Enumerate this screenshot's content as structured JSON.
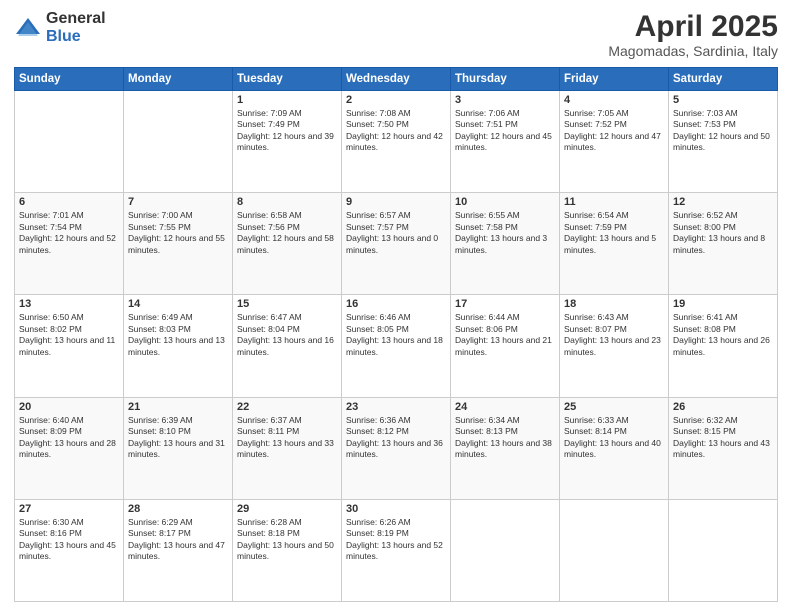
{
  "logo": {
    "general": "General",
    "blue": "Blue"
  },
  "title": {
    "month": "April 2025",
    "location": "Magomadas, Sardinia, Italy"
  },
  "weekdays": [
    "Sunday",
    "Monday",
    "Tuesday",
    "Wednesday",
    "Thursday",
    "Friday",
    "Saturday"
  ],
  "weeks": [
    [
      {
        "day": "",
        "info": ""
      },
      {
        "day": "",
        "info": ""
      },
      {
        "day": "1",
        "info": "Sunrise: 7:09 AM\nSunset: 7:49 PM\nDaylight: 12 hours and 39 minutes."
      },
      {
        "day": "2",
        "info": "Sunrise: 7:08 AM\nSunset: 7:50 PM\nDaylight: 12 hours and 42 minutes."
      },
      {
        "day": "3",
        "info": "Sunrise: 7:06 AM\nSunset: 7:51 PM\nDaylight: 12 hours and 45 minutes."
      },
      {
        "day": "4",
        "info": "Sunrise: 7:05 AM\nSunset: 7:52 PM\nDaylight: 12 hours and 47 minutes."
      },
      {
        "day": "5",
        "info": "Sunrise: 7:03 AM\nSunset: 7:53 PM\nDaylight: 12 hours and 50 minutes."
      }
    ],
    [
      {
        "day": "6",
        "info": "Sunrise: 7:01 AM\nSunset: 7:54 PM\nDaylight: 12 hours and 52 minutes."
      },
      {
        "day": "7",
        "info": "Sunrise: 7:00 AM\nSunset: 7:55 PM\nDaylight: 12 hours and 55 minutes."
      },
      {
        "day": "8",
        "info": "Sunrise: 6:58 AM\nSunset: 7:56 PM\nDaylight: 12 hours and 58 minutes."
      },
      {
        "day": "9",
        "info": "Sunrise: 6:57 AM\nSunset: 7:57 PM\nDaylight: 13 hours and 0 minutes."
      },
      {
        "day": "10",
        "info": "Sunrise: 6:55 AM\nSunset: 7:58 PM\nDaylight: 13 hours and 3 minutes."
      },
      {
        "day": "11",
        "info": "Sunrise: 6:54 AM\nSunset: 7:59 PM\nDaylight: 13 hours and 5 minutes."
      },
      {
        "day": "12",
        "info": "Sunrise: 6:52 AM\nSunset: 8:00 PM\nDaylight: 13 hours and 8 minutes."
      }
    ],
    [
      {
        "day": "13",
        "info": "Sunrise: 6:50 AM\nSunset: 8:02 PM\nDaylight: 13 hours and 11 minutes."
      },
      {
        "day": "14",
        "info": "Sunrise: 6:49 AM\nSunset: 8:03 PM\nDaylight: 13 hours and 13 minutes."
      },
      {
        "day": "15",
        "info": "Sunrise: 6:47 AM\nSunset: 8:04 PM\nDaylight: 13 hours and 16 minutes."
      },
      {
        "day": "16",
        "info": "Sunrise: 6:46 AM\nSunset: 8:05 PM\nDaylight: 13 hours and 18 minutes."
      },
      {
        "day": "17",
        "info": "Sunrise: 6:44 AM\nSunset: 8:06 PM\nDaylight: 13 hours and 21 minutes."
      },
      {
        "day": "18",
        "info": "Sunrise: 6:43 AM\nSunset: 8:07 PM\nDaylight: 13 hours and 23 minutes."
      },
      {
        "day": "19",
        "info": "Sunrise: 6:41 AM\nSunset: 8:08 PM\nDaylight: 13 hours and 26 minutes."
      }
    ],
    [
      {
        "day": "20",
        "info": "Sunrise: 6:40 AM\nSunset: 8:09 PM\nDaylight: 13 hours and 28 minutes."
      },
      {
        "day": "21",
        "info": "Sunrise: 6:39 AM\nSunset: 8:10 PM\nDaylight: 13 hours and 31 minutes."
      },
      {
        "day": "22",
        "info": "Sunrise: 6:37 AM\nSunset: 8:11 PM\nDaylight: 13 hours and 33 minutes."
      },
      {
        "day": "23",
        "info": "Sunrise: 6:36 AM\nSunset: 8:12 PM\nDaylight: 13 hours and 36 minutes."
      },
      {
        "day": "24",
        "info": "Sunrise: 6:34 AM\nSunset: 8:13 PM\nDaylight: 13 hours and 38 minutes."
      },
      {
        "day": "25",
        "info": "Sunrise: 6:33 AM\nSunset: 8:14 PM\nDaylight: 13 hours and 40 minutes."
      },
      {
        "day": "26",
        "info": "Sunrise: 6:32 AM\nSunset: 8:15 PM\nDaylight: 13 hours and 43 minutes."
      }
    ],
    [
      {
        "day": "27",
        "info": "Sunrise: 6:30 AM\nSunset: 8:16 PM\nDaylight: 13 hours and 45 minutes."
      },
      {
        "day": "28",
        "info": "Sunrise: 6:29 AM\nSunset: 8:17 PM\nDaylight: 13 hours and 47 minutes."
      },
      {
        "day": "29",
        "info": "Sunrise: 6:28 AM\nSunset: 8:18 PM\nDaylight: 13 hours and 50 minutes."
      },
      {
        "day": "30",
        "info": "Sunrise: 6:26 AM\nSunset: 8:19 PM\nDaylight: 13 hours and 52 minutes."
      },
      {
        "day": "",
        "info": ""
      },
      {
        "day": "",
        "info": ""
      },
      {
        "day": "",
        "info": ""
      }
    ]
  ]
}
